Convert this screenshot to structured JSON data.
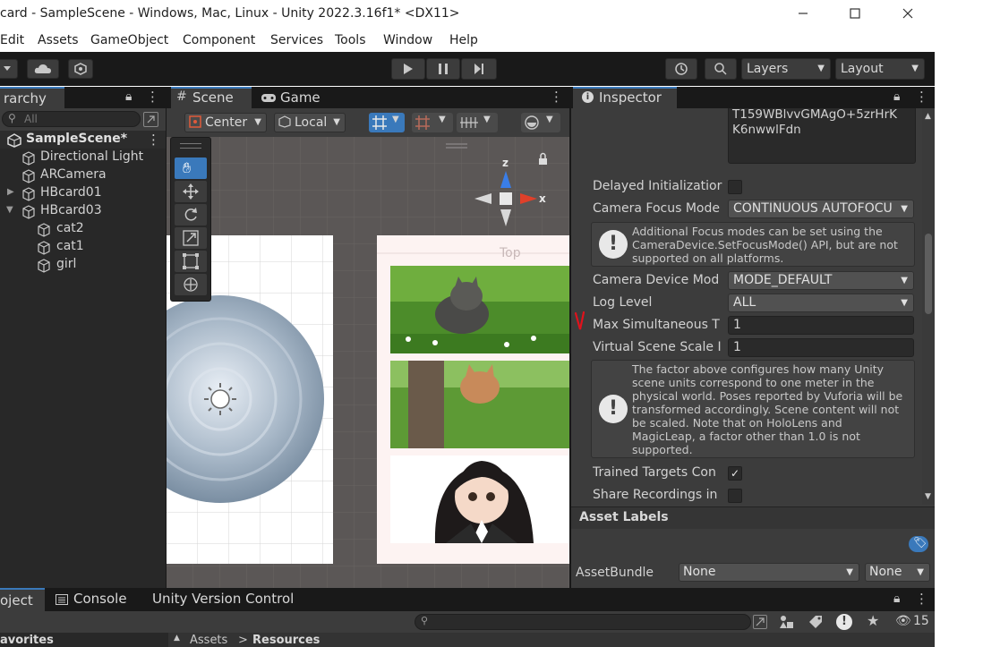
{
  "window": {
    "title": "card - SampleScene - Windows, Mac, Linux - Unity 2022.3.16f1* <DX11>"
  },
  "menu": [
    "Edit",
    "Assets",
    "GameObject",
    "Component",
    "Services",
    "Tools",
    "Window",
    "Help"
  ],
  "toolbar": {
    "layers_label": "Layers",
    "layout_label": "Layout"
  },
  "hierarchy": {
    "tab_label": "rarchy",
    "search_placeholder": "All",
    "items": [
      {
        "label": "SampleScene*"
      },
      {
        "label": "Directional Light"
      },
      {
        "label": "ARCamera"
      },
      {
        "label": "HBcard01"
      },
      {
        "label": "HBcard03"
      },
      {
        "label": "cat2"
      },
      {
        "label": "cat1"
      },
      {
        "label": "girl"
      }
    ]
  },
  "scene": {
    "tab_scene": "Scene",
    "tab_game": "Game",
    "pivot_label": "Center",
    "space_label": "Local",
    "gizmo_top_label": "Top",
    "axis_z": "z",
    "axis_x": "x"
  },
  "inspector": {
    "tab_label": "Inspector",
    "license_text": "T159WBlvvGMAgO+5zrHrK\nK6nwwlFdn",
    "fields": {
      "delayed_init_label": "Delayed Initializatior",
      "camera_focus_label": "Camera Focus Mode",
      "camera_focus_value": "CONTINUOUS AUTOFOCU",
      "focus_help": "Additional Focus modes can be set using the CameraDevice.SetFocusMode() API, but are not supported on all platforms.",
      "camera_device_label": "Camera Device Mod",
      "camera_device_value": "MODE_DEFAULT",
      "log_level_label": "Log Level",
      "log_level_value": "ALL",
      "max_sim_label": "Max Simultaneous T",
      "max_sim_value": "1",
      "virtual_scale_label": "Virtual Scene Scale I",
      "virtual_scale_value": "1",
      "scale_help": "The factor above configures how many Unity scene units correspond to one meter in the physical world. Poses reported by Vuforia will be transformed accordingly. Scene content will not be scaled. Note that on HoloLens and MagicLeap, a factor other than 1.0 is not supported.",
      "trained_targets_label": "Trained Targets Con",
      "share_recordings_label": "Share Recordings in"
    },
    "asset_labels_title": "Asset Labels",
    "asset_bundle_label": "AssetBundle",
    "asset_bundle_value": "None",
    "asset_variant_value": "None"
  },
  "bottom": {
    "tab_project": "oject",
    "tab_console": "Console",
    "tab_uvc": "Unity Version Control",
    "hidden_count": "15",
    "favorites_label": "avorites",
    "breadcrumb_assets": "Assets",
    "breadcrumb_sep": ">",
    "breadcrumb_resources": "Resources"
  },
  "colors": {
    "accent": "#3a79bb",
    "annotation_red": "#e0121c"
  }
}
